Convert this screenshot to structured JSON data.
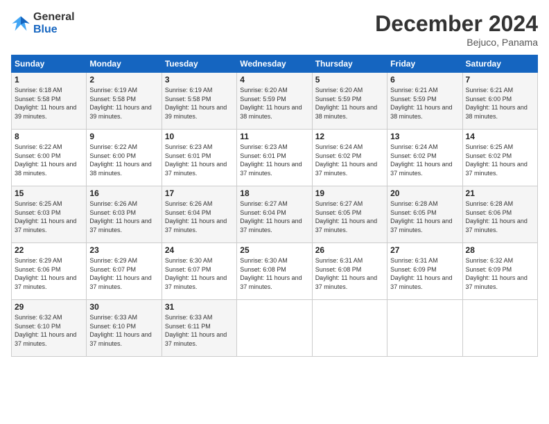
{
  "logo": {
    "line1": "General",
    "line2": "Blue"
  },
  "title": "December 2024",
  "location": "Bejuco, Panama",
  "days_of_week": [
    "Sunday",
    "Monday",
    "Tuesday",
    "Wednesday",
    "Thursday",
    "Friday",
    "Saturday"
  ],
  "weeks": [
    [
      {
        "day": "1",
        "sunrise": "6:18 AM",
        "sunset": "5:58 PM",
        "daylight": "11 hours and 39 minutes."
      },
      {
        "day": "2",
        "sunrise": "6:19 AM",
        "sunset": "5:58 PM",
        "daylight": "11 hours and 39 minutes."
      },
      {
        "day": "3",
        "sunrise": "6:19 AM",
        "sunset": "5:58 PM",
        "daylight": "11 hours and 39 minutes."
      },
      {
        "day": "4",
        "sunrise": "6:20 AM",
        "sunset": "5:59 PM",
        "daylight": "11 hours and 38 minutes."
      },
      {
        "day": "5",
        "sunrise": "6:20 AM",
        "sunset": "5:59 PM",
        "daylight": "11 hours and 38 minutes."
      },
      {
        "day": "6",
        "sunrise": "6:21 AM",
        "sunset": "5:59 PM",
        "daylight": "11 hours and 38 minutes."
      },
      {
        "day": "7",
        "sunrise": "6:21 AM",
        "sunset": "6:00 PM",
        "daylight": "11 hours and 38 minutes."
      }
    ],
    [
      {
        "day": "8",
        "sunrise": "6:22 AM",
        "sunset": "6:00 PM",
        "daylight": "11 hours and 38 minutes."
      },
      {
        "day": "9",
        "sunrise": "6:22 AM",
        "sunset": "6:00 PM",
        "daylight": "11 hours and 38 minutes."
      },
      {
        "day": "10",
        "sunrise": "6:23 AM",
        "sunset": "6:01 PM",
        "daylight": "11 hours and 37 minutes."
      },
      {
        "day": "11",
        "sunrise": "6:23 AM",
        "sunset": "6:01 PM",
        "daylight": "11 hours and 37 minutes."
      },
      {
        "day": "12",
        "sunrise": "6:24 AM",
        "sunset": "6:02 PM",
        "daylight": "11 hours and 37 minutes."
      },
      {
        "day": "13",
        "sunrise": "6:24 AM",
        "sunset": "6:02 PM",
        "daylight": "11 hours and 37 minutes."
      },
      {
        "day": "14",
        "sunrise": "6:25 AM",
        "sunset": "6:02 PM",
        "daylight": "11 hours and 37 minutes."
      }
    ],
    [
      {
        "day": "15",
        "sunrise": "6:25 AM",
        "sunset": "6:03 PM",
        "daylight": "11 hours and 37 minutes."
      },
      {
        "day": "16",
        "sunrise": "6:26 AM",
        "sunset": "6:03 PM",
        "daylight": "11 hours and 37 minutes."
      },
      {
        "day": "17",
        "sunrise": "6:26 AM",
        "sunset": "6:04 PM",
        "daylight": "11 hours and 37 minutes."
      },
      {
        "day": "18",
        "sunrise": "6:27 AM",
        "sunset": "6:04 PM",
        "daylight": "11 hours and 37 minutes."
      },
      {
        "day": "19",
        "sunrise": "6:27 AM",
        "sunset": "6:05 PM",
        "daylight": "11 hours and 37 minutes."
      },
      {
        "day": "20",
        "sunrise": "6:28 AM",
        "sunset": "6:05 PM",
        "daylight": "11 hours and 37 minutes."
      },
      {
        "day": "21",
        "sunrise": "6:28 AM",
        "sunset": "6:06 PM",
        "daylight": "11 hours and 37 minutes."
      }
    ],
    [
      {
        "day": "22",
        "sunrise": "6:29 AM",
        "sunset": "6:06 PM",
        "daylight": "11 hours and 37 minutes."
      },
      {
        "day": "23",
        "sunrise": "6:29 AM",
        "sunset": "6:07 PM",
        "daylight": "11 hours and 37 minutes."
      },
      {
        "day": "24",
        "sunrise": "6:30 AM",
        "sunset": "6:07 PM",
        "daylight": "11 hours and 37 minutes."
      },
      {
        "day": "25",
        "sunrise": "6:30 AM",
        "sunset": "6:08 PM",
        "daylight": "11 hours and 37 minutes."
      },
      {
        "day": "26",
        "sunrise": "6:31 AM",
        "sunset": "6:08 PM",
        "daylight": "11 hours and 37 minutes."
      },
      {
        "day": "27",
        "sunrise": "6:31 AM",
        "sunset": "6:09 PM",
        "daylight": "11 hours and 37 minutes."
      },
      {
        "day": "28",
        "sunrise": "6:32 AM",
        "sunset": "6:09 PM",
        "daylight": "11 hours and 37 minutes."
      }
    ],
    [
      {
        "day": "29",
        "sunrise": "6:32 AM",
        "sunset": "6:10 PM",
        "daylight": "11 hours and 37 minutes."
      },
      {
        "day": "30",
        "sunrise": "6:33 AM",
        "sunset": "6:10 PM",
        "daylight": "11 hours and 37 minutes."
      },
      {
        "day": "31",
        "sunrise": "6:33 AM",
        "sunset": "6:11 PM",
        "daylight": "11 hours and 37 minutes."
      },
      null,
      null,
      null,
      null
    ]
  ],
  "labels": {
    "sunrise": "Sunrise:",
    "sunset": "Sunset:",
    "daylight": "Daylight:"
  }
}
